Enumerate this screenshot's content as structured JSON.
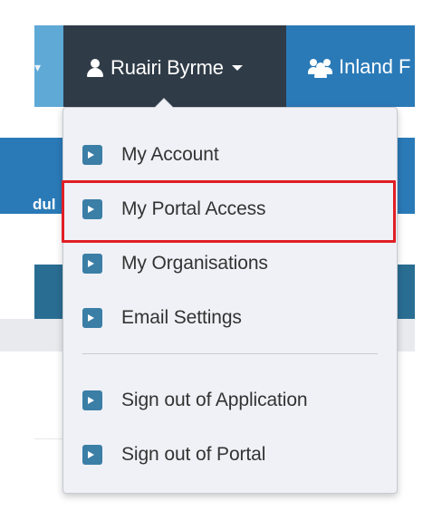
{
  "navbar": {
    "user_name": "Ruairi Byrme",
    "group_label": "Inland F",
    "left_partial_text": "dul"
  },
  "menu": {
    "items": [
      {
        "label": "My Account",
        "icon": "chevron-right-icon"
      },
      {
        "label": "My Portal Access",
        "icon": "chevron-right-icon",
        "highlighted": true
      },
      {
        "label": "My Organisations",
        "icon": "chevron-right-icon"
      },
      {
        "label": "Email Settings",
        "icon": "chevron-right-icon"
      },
      {
        "label": "Sign out of Application",
        "icon": "chevron-right-icon"
      },
      {
        "label": "Sign out of Portal",
        "icon": "chevron-right-icon"
      }
    ]
  },
  "colors": {
    "navbar_dark": "#2f3b47",
    "navbar_blue": "#2a7ab8",
    "menu_bg": "#eff1f6",
    "icon_bg": "#3b7ea6",
    "highlight": "#e01e25"
  }
}
